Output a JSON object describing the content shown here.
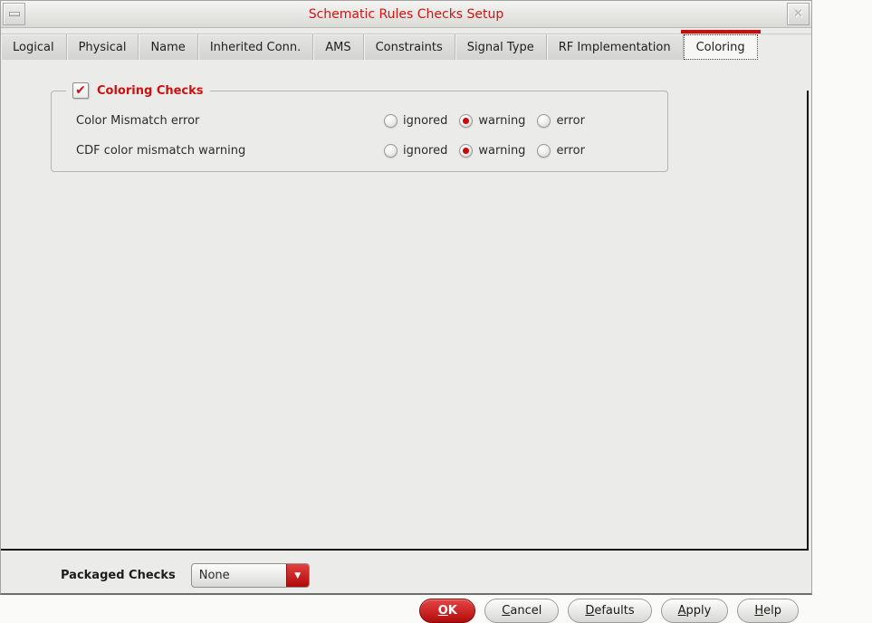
{
  "window": {
    "title": "Schematic Rules Checks Setup"
  },
  "icons": {
    "close": "✕",
    "check": "✔",
    "dropdown_arrow": "▼"
  },
  "tabs": [
    {
      "label": "Logical"
    },
    {
      "label": "Physical"
    },
    {
      "label": "Name"
    },
    {
      "label": "Inherited Conn."
    },
    {
      "label": "AMS"
    },
    {
      "label": "Constraints"
    },
    {
      "label": "Signal Type"
    },
    {
      "label": "RF Implementation"
    },
    {
      "label": "Coloring"
    }
  ],
  "active_tab": "Coloring",
  "checks": {
    "group_title": "Coloring Checks",
    "group_checked": true,
    "rows": [
      {
        "label": "Color Mismatch error",
        "options": [
          "ignored",
          "warning",
          "error"
        ],
        "selected": "warning"
      },
      {
        "label": "CDF color mismatch warning",
        "options": [
          "ignored",
          "warning",
          "error"
        ],
        "selected": "warning"
      }
    ]
  },
  "footer": {
    "packaged_checks_label": "Packaged Checks",
    "packaged_checks_value": "None",
    "buttons": [
      {
        "name": "ok",
        "mnemonic": "O",
        "rest": "K"
      },
      {
        "name": "cancel",
        "mnemonic": "C",
        "rest": "ancel"
      },
      {
        "name": "defaults",
        "mnemonic": "D",
        "rest": "efaults"
      },
      {
        "name": "apply",
        "mnemonic": "A",
        "rest": "pply"
      },
      {
        "name": "help",
        "mnemonic": "H",
        "rest": "elp"
      }
    ]
  },
  "colors": {
    "accent_red": "#cc0b0b",
    "title_red": "#d01414",
    "window_bg": "#ebebe9",
    "panel_border": "#161616"
  }
}
